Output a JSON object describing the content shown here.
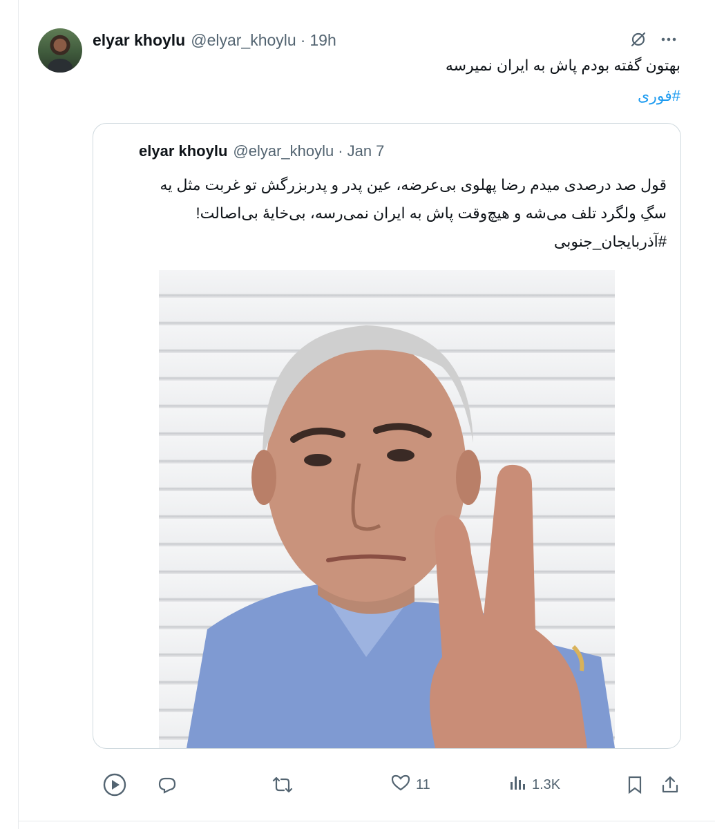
{
  "tweet": {
    "author_name": "elyar khoylu",
    "author_handle": "@elyar_khoylu",
    "separator": "·",
    "time": "19h",
    "text": "بهتون گفته بودم پاش به ایران نمیرسه",
    "hashtag": "#فوری"
  },
  "quoted": {
    "author_name": "elyar khoylu",
    "author_handle": "@elyar_khoylu",
    "separator": "·",
    "date": "Jan 7",
    "lines": [
      "قول صد درصدی میدم رضا پهلوی بی‌عرضه، عین پدر و پدربزرگش تو غربت مثل یه",
      "سگِ ولگرد تلف می‌شه و هیچ‌وقت پاش به ایران نمی‌رسه، بی‌خایهٔ بی‌اصالت!",
      "#آذربایجان_جنوبی"
    ],
    "media_alt": "video still of a man holding up two fingers"
  },
  "actions": {
    "likes": "11",
    "views": "1.3K"
  },
  "icons": {
    "top": [
      "grok-icon",
      "more-icon"
    ],
    "bottom": [
      "play-icon",
      "reply-icon",
      "retweet-icon",
      "like-icon",
      "views-icon",
      "bookmark-icon",
      "share-icon"
    ]
  },
  "colors": {
    "text": "#0f1419",
    "secondary": "#536471",
    "link": "#1d9bf0",
    "border": "#cfd9de"
  }
}
